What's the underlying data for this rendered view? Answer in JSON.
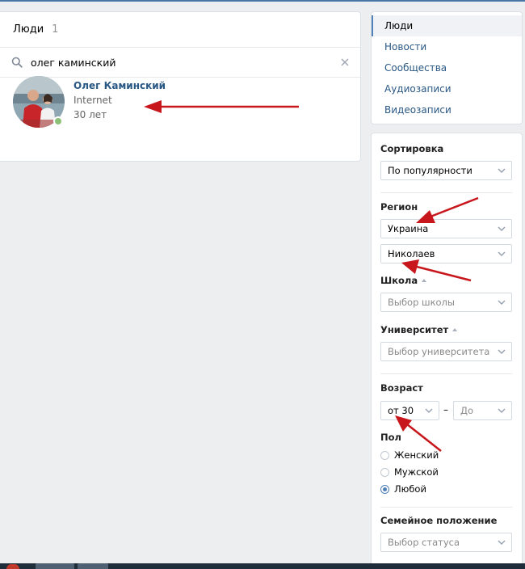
{
  "results": {
    "title": "Люди",
    "count": "1",
    "search": {
      "value": "олег каминский",
      "icon": "search-icon",
      "clear_icon": "close-icon"
    },
    "person": {
      "name": "Олег Каминский",
      "work": "Internet",
      "age": "30 лет",
      "online": true
    }
  },
  "menu": {
    "items": [
      {
        "label": "Люди",
        "active": true
      },
      {
        "label": "Новости"
      },
      {
        "label": "Сообщества"
      },
      {
        "label": "Аудиозаписи"
      },
      {
        "label": "Видеозаписи"
      }
    ]
  },
  "filters": {
    "sort_label": "Сортировка",
    "sort_value": "По популярности",
    "region_label": "Регион",
    "country_value": "Украина",
    "city_value": "Николаев",
    "school_label": "Школа",
    "school_placeholder": "Выбор школы",
    "university_label": "Университет",
    "university_placeholder": "Выбор университета",
    "age_label": "Возраст",
    "age_from": "от 30",
    "age_dash": "–",
    "age_to": "До",
    "gender_label": "Пол",
    "gender_options": [
      "Женский",
      "Мужской",
      "Любой"
    ],
    "gender_selected": "Любой",
    "marital_label": "Семейное положение",
    "marital_placeholder": "Выбор статуса"
  },
  "colors": {
    "accent": "#5181b8",
    "link": "#2a5885",
    "background": "#edeef0",
    "annotation_arrow": "#c8171c",
    "online": "#8ac176"
  }
}
